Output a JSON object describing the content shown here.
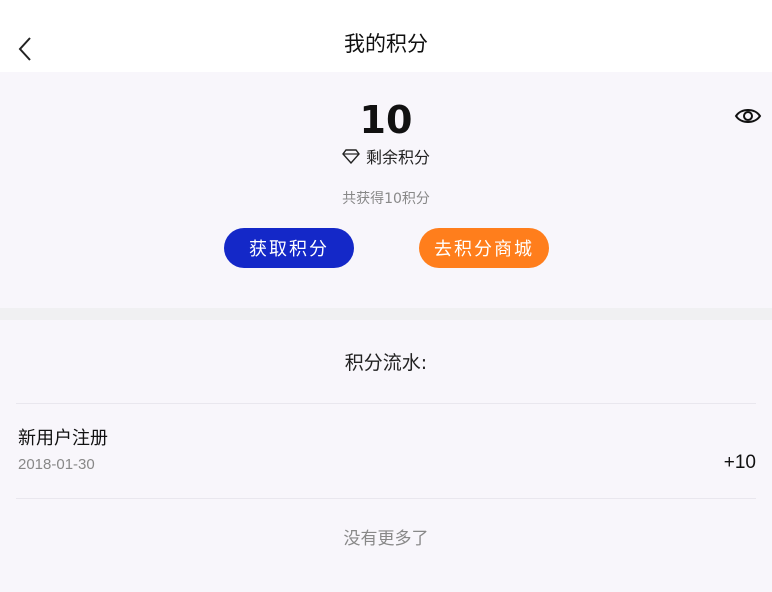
{
  "nav": {
    "title": "我的积分",
    "back_icon": "chevron-left-icon"
  },
  "summary": {
    "points": "10",
    "remaining_label": "剩余积分",
    "gem_icon": "diamond-icon",
    "eye_icon": "eye-icon",
    "total_text": "共获得10积分",
    "earn_button": "获取积分",
    "mall_button": "去积分商城",
    "colors": {
      "earn_button": "#1428c8",
      "mall_button": "#ff7e1c"
    }
  },
  "ledger": {
    "title": "积分流水:",
    "items": [
      {
        "title": "新用户注册",
        "date": "2018-01-30",
        "amount": "+10"
      }
    ],
    "end_text": "没有更多了"
  }
}
